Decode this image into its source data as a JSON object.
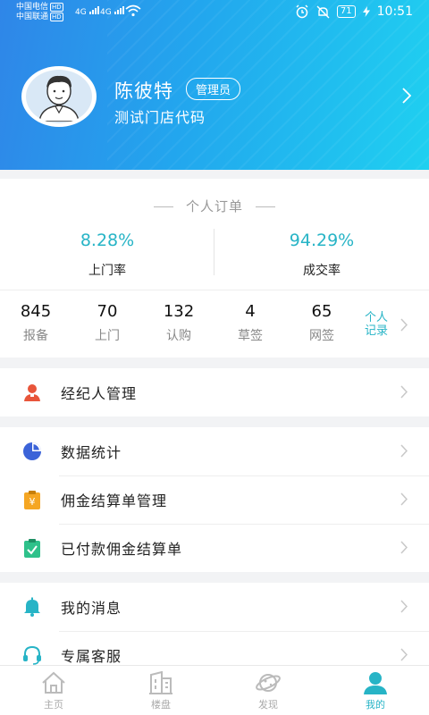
{
  "status_bar": {
    "carrier1": "中国电信",
    "carrier2": "中国联通",
    "hd": "HD",
    "net": "4G",
    "battery": "71",
    "time": "10:51"
  },
  "profile": {
    "name": "陈彼特",
    "role": "管理员",
    "store_code": "测试门店代码"
  },
  "orders": {
    "title": "个人订单",
    "rates": [
      {
        "value": "8.28%",
        "label": "上门率"
      },
      {
        "value": "94.29%",
        "label": "成交率"
      }
    ],
    "stats": [
      {
        "value": "845",
        "label": "报备"
      },
      {
        "value": "70",
        "label": "上门"
      },
      {
        "value": "132",
        "label": "认购"
      },
      {
        "value": "4",
        "label": "草签"
      },
      {
        "value": "65",
        "label": "网签"
      }
    ],
    "personal_record_line1": "个人",
    "personal_record_line2": "记录"
  },
  "menu": {
    "agent_management": "经纪人管理",
    "data_statistics": "数据统计",
    "commission_settlement": "佣金结算单管理",
    "paid_commission": "已付款佣金结算单",
    "my_messages": "我的消息",
    "customer_service": "专属客服"
  },
  "tabs": [
    {
      "label": "主页",
      "icon": "home-icon"
    },
    {
      "label": "楼盘",
      "icon": "building-icon"
    },
    {
      "label": "发现",
      "icon": "planet-icon"
    },
    {
      "label": "我的",
      "icon": "user-icon"
    }
  ],
  "colors": {
    "accent": "#27b4c6",
    "header_start": "#2f86e8",
    "header_end": "#1fd0f0"
  }
}
